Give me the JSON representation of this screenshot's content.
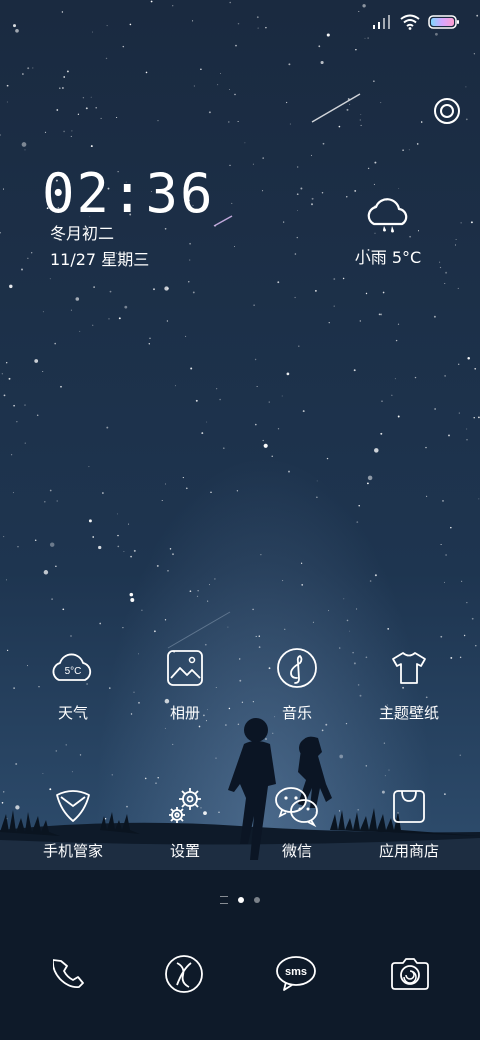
{
  "status": {
    "signal_icon": "signal-icon",
    "wifi_icon": "wifi-icon",
    "battery_icon": "battery-icon"
  },
  "clock": {
    "time": "02:36",
    "lunar": "冬月初二",
    "date": "11/27 星期三"
  },
  "weather": {
    "icon": "rain-cloud-icon",
    "text": "小雨 5°C"
  },
  "apps": [
    {
      "label": "天气",
      "icon": "weather-icon",
      "badge": "5°C"
    },
    {
      "label": "相册",
      "icon": "gallery-icon"
    },
    {
      "label": "音乐",
      "icon": "music-icon"
    },
    {
      "label": "主题壁纸",
      "icon": "theme-shirt-icon"
    },
    {
      "label": "手机管家",
      "icon": "shield-icon"
    },
    {
      "label": "设置",
      "icon": "settings-gear-icon"
    },
    {
      "label": "微信",
      "icon": "wechat-icon"
    },
    {
      "label": "应用商店",
      "icon": "app-store-bag-icon"
    }
  ],
  "dock": [
    {
      "icon": "phone-icon"
    },
    {
      "icon": "browser-icon"
    },
    {
      "icon": "sms-icon",
      "text": "sms"
    },
    {
      "icon": "camera-icon"
    }
  ],
  "colors": {
    "sky_top": "#15243a",
    "sky_bottom": "#0b1626",
    "icon_stroke": "#ffffff"
  }
}
